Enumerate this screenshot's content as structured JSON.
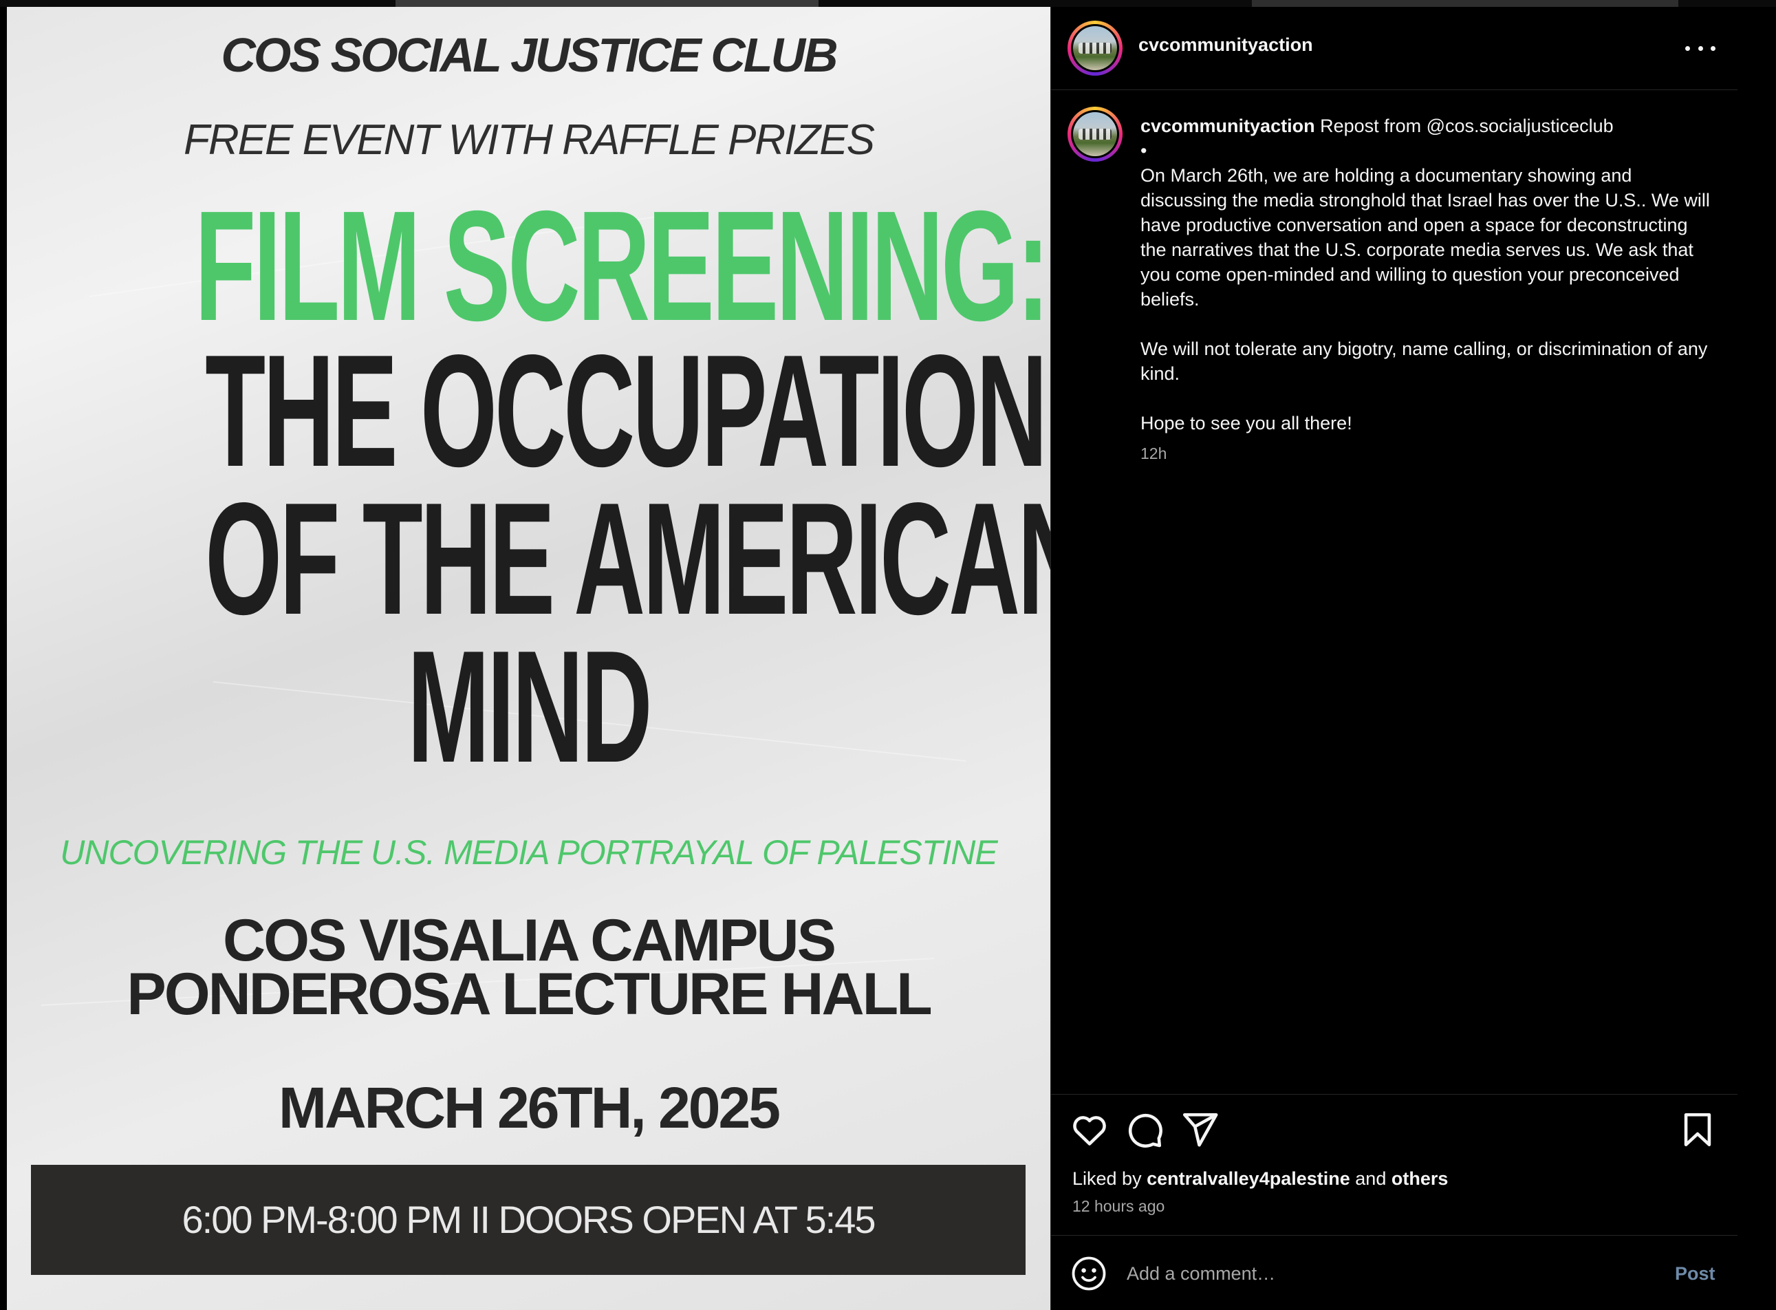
{
  "poster": {
    "club": "COS SOCIAL JUSTICE CLUB",
    "free_event": "FREE EVENT WITH RAFFLE PRIZES",
    "film_screening": "FILM SCREENING:",
    "title_lines": [
      "THE OCCUPATION",
      "OF THE AMERICAN",
      "MIND"
    ],
    "subtitle": "UNCOVERING THE  U.S. MEDIA PORTRAYAL OF PALESTINE",
    "campus_lines": [
      "COS  VISALIA CAMPUS",
      "PONDEROSA LECTURE HALL"
    ],
    "date": "MARCH 26TH, 2025",
    "time": "6:00 PM-8:00 PM II DOORS OPEN AT 5:45"
  },
  "header": {
    "username": "cvcommunityaction",
    "more_icon": "more-horizontal-icon"
  },
  "caption": {
    "username": "cvcommunityaction",
    "repost": "Repost from @cos.socialjusticeclub",
    "bullet": "•",
    "para1": "On March 26th, we are holding a documentary showing and discussing the media stronghold that Israel has over the U.S.. We will have productive conversation and open a space for deconstructing the narratives that the U.S. corporate media serves us. We ask that you come open-minded and willing to question your preconceived beliefs.",
    "para2": "We will not tolerate any bigotry, name calling, or discrimination of any kind.",
    "para3": "Hope to see you all there!",
    "time": "12h"
  },
  "actions": {
    "icons": [
      "heart-icon",
      "comment-icon",
      "share-icon",
      "bookmark-icon"
    ],
    "liked_prefix": "Liked by",
    "liked_user": "centralvalley4palestine",
    "liked_and": "and",
    "liked_others": "others",
    "time_ago": "12 hours ago"
  },
  "comment": {
    "placeholder": "Add a comment…",
    "post_label": "Post",
    "emoji_icon": "emoji-icon"
  },
  "colors": {
    "accent_green": "#4ec76b",
    "post_disabled": "#6e8aa8",
    "secondary_text": "#a8a8a8"
  }
}
